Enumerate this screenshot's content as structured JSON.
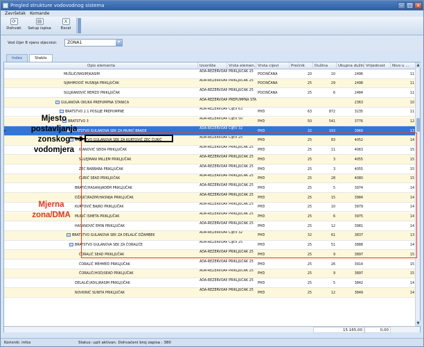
{
  "window": {
    "title": "Pregled strukture vodovodnog sistema"
  },
  "menu": [
    "Završetak",
    "Komande"
  ],
  "toolbar": {
    "refresh": "Dohvati",
    "print": "Setup ispisa",
    "excel": "Excel"
  },
  "filter": {
    "label": "Vod čijer 8 njens sljecnioi:",
    "value": "ZONA1"
  },
  "tabs": [
    "Index",
    "Stablo"
  ],
  "columns": [
    "Opis elementa",
    "Izvorište",
    "Vrsta elemen...",
    "Vrsta cijevi",
    "Prečnik",
    "Dužina",
    "Ukupna dužina",
    "Vrijednost",
    "Nivo u ..."
  ],
  "rows": [
    {
      "name": "MUŠLIĆ(RASIM)KASIM",
      "izv": "ADA-REZERVOAR HUM",
      "vrsta": "PRIKLJUČAK 25",
      "cijev": "POCINČANA",
      "p": "20",
      "d": "10",
      "ud": "2496",
      "v": "",
      "n": "11"
    },
    {
      "name": "SIJAHMOOIĆ HUSNIJA PRIKLJUČAK",
      "izv": "ADA-REZERVOAR HUM",
      "vrsta": "PRIKLJUČAK 25",
      "cijev": "POCINČANA",
      "p": "25",
      "d": "29",
      "ud": "2498",
      "v": "",
      "n": "11"
    },
    {
      "name": "SULJKANOVIĆ REMZO PRIKLJUČAK",
      "izv": "ADA-REZERVOAR HUM",
      "vrsta": "PRIKLJUČAK 25",
      "cijev": "POCINČANA",
      "p": "25",
      "d": "6",
      "ud": "2484",
      "v": "",
      "n": "11"
    },
    {
      "name": "GULANOVA OKUKA PREPUMPNA STANICA",
      "izv": "ADA-REZERVOAR HUM",
      "vrsta": "PREPUMPNA STANICA",
      "cijev": "",
      "p": "",
      "d": "",
      "ud": "2363",
      "v": "",
      "n": "10"
    },
    {
      "name": "BRATSTVO 2.1 POSLIJE PREPUMPNE",
      "izv": "ADA-REZERVOAR HUM",
      "vrsta": "CIJEV 63",
      "cijev": "PHD",
      "p": "63",
      "d": "872",
      "ud": "3235",
      "v": "",
      "n": "11"
    },
    {
      "name": "BRATSTVO 3",
      "izv": "ADA-REZERVOAR HUM",
      "vrsta": "CIJEV 50",
      "cijev": "PHD",
      "p": "50",
      "d": "541",
      "ud": "3776",
      "v": "",
      "n": "12"
    },
    {
      "name": "BRATSTVO GULANOVA SEK ZA MURIĆ BRADE",
      "izv": "ADA-REZERVOAR HUM",
      "vrsta": "CIJEV 32",
      "cijev": "PHD",
      "p": "32",
      "d": "193",
      "ud": "3969",
      "v": "",
      "n": "13"
    },
    {
      "name": "BRATSTVO GULANOVA SEK ZA KURTOVIĆ ZEC ĆURIĆ",
      "izv": "ADA-REZERVOAR HUM",
      "vrsta": "CIJEV 25",
      "cijev": "PHD",
      "p": "25",
      "d": "83",
      "ud": "4052",
      "v": "",
      "n": "14"
    },
    {
      "name": "IĆANOVIĆ SEIDA PRIKLJUČAK",
      "izv": "ADA-REZERVOAR HUM",
      "vrsta": "PRIKLJUČAK 25",
      "cijev": "PHD",
      "p": "25",
      "d": "11",
      "ud": "4063",
      "v": "",
      "n": "15"
    },
    {
      "name": "SULEJMANI MILLEM PRIKLJUČAK",
      "izv": "ADA-REZERVOAR HUM",
      "vrsta": "PRIKLJUČAK 25",
      "cijev": "PHD",
      "p": "25",
      "d": "3",
      "ud": "4055",
      "v": "",
      "n": "15"
    },
    {
      "name": "ZEC BARBARA PRIKLJUČAK",
      "izv": "ADA-REZERVOAR HUM",
      "vrsta": "PRIKLJUČAK 25",
      "cijev": "PHD",
      "p": "25",
      "d": "3",
      "ud": "4055",
      "v": "",
      "n": "15"
    },
    {
      "name": "ĆURIĆ SEAD PRIKLJUČAK",
      "izv": "ADA-REZERVOAR HUM",
      "vrsta": "PRIKLJUČAK 25",
      "cijev": "PHD",
      "p": "25",
      "d": "28",
      "ud": "4080",
      "v": "",
      "n": "15"
    },
    {
      "name": "BRATIĆ(HASAN)JADEM PRIKLJUČAK",
      "izv": "ADA-REZERVOAR HUM",
      "vrsta": "PRIKLJUČAK 25",
      "cijev": "PHD",
      "p": "25",
      "d": "5",
      "ud": "3974",
      "v": "",
      "n": "14"
    },
    {
      "name": "DŽAJIĆ(RAZIM)HASNIJA PRIKLJUČAK",
      "izv": "ADA-REZERVOAR HUM",
      "vrsta": "PRIKLJUČAK 25",
      "cijev": "PHD",
      "p": "25",
      "d": "15",
      "ud": "3984",
      "v": "",
      "n": "14"
    },
    {
      "name": "KURTOVIĆ BAJRO PRIKLJUČAK",
      "izv": "ADA-REZERVOAR HUM",
      "vrsta": "PRIKLJUČAK 25",
      "cijev": "PHD",
      "p": "25",
      "d": "10",
      "ud": "3979",
      "v": "",
      "n": "14"
    },
    {
      "name": "MURIĆ ISMETA PRIKLJUČAK",
      "izv": "ADA-REZERVOAR HUM",
      "vrsta": "PRIKLJUČAK 25",
      "cijev": "PHD",
      "p": "25",
      "d": "6",
      "ud": "3975",
      "v": "",
      "n": "14"
    },
    {
      "name": "HASANOVIĆ EMIN PRIKLJUČAK",
      "izv": "ADA-REZERVOAR HUM",
      "vrsta": "PRIKLJUČAK 25",
      "cijev": "PHD",
      "p": "25",
      "d": "12",
      "ud": "3981",
      "v": "",
      "n": "14"
    },
    {
      "name": "BRATSTVO GULANOVA SEK ZA DELALIĆ DŽAMBEK",
      "izv": "ADA-REZERVOAR HUM",
      "vrsta": "CIJEV 32",
      "cijev": "PHD",
      "p": "32",
      "d": "61",
      "ud": "3837",
      "v": "",
      "n": "13"
    },
    {
      "name": "BRATSTVO GULANOVA SEK ZA ĆORALIĆE",
      "izv": "ADA-REZERVOAR HUM",
      "vrsta": "CIJEV 25",
      "cijev": "PHD",
      "p": "25",
      "d": "51",
      "ud": "3888",
      "v": "",
      "n": "14"
    },
    {
      "name": "ĆORALIĆ SEAD PRIKLJUČAK",
      "izv": "ADA-REZERVOAR HUM",
      "vrsta": "PRIKLJUČAK 25",
      "cijev": "PHD",
      "p": "25",
      "d": "9",
      "ud": "3897",
      "v": "",
      "n": "15"
    },
    {
      "name": "ĆORALIĆ MEHMED PRIKLJUČAK",
      "izv": "ADA-REZERVOAR HUM",
      "vrsta": "PRIKLJUČAK 25",
      "cijev": "PHD",
      "p": "25",
      "d": "26",
      "ud": "3914",
      "v": "",
      "n": "15"
    },
    {
      "name": "ĆORALIĆ(HOD)SEAD PRIKLJUČAK",
      "izv": "ADA-REZERVOAR HUM",
      "vrsta": "PRIKLJUČAK 25",
      "cijev": "PHD",
      "p": "25",
      "d": "9",
      "ud": "3897",
      "v": "",
      "n": "15"
    },
    {
      "name": "DELALIĆ(ADIL)RASIM PRIKLJUČAK",
      "izv": "ADA-REZERVOAR HUM",
      "vrsta": "PRIKLJUČAK 25",
      "cijev": "PHD",
      "p": "25",
      "d": "5",
      "ud": "3842",
      "v": "",
      "n": "14"
    },
    {
      "name": "NOVKINIĆ SUNITA PRIKLJUČAK",
      "izv": "ADA-REZERVOAR HUM",
      "vrsta": "PRIKLJUČAK 25",
      "cijev": "PHD",
      "p": "25",
      "d": "12",
      "ud": "3849",
      "v": "",
      "n": "14"
    }
  ],
  "footer": {
    "total_len": "15.165,00",
    "total_value": "0,00"
  },
  "status": {
    "user": "Korisnik: infos",
    "state": "Status: upit aktivan. Dohvaćeni broj zapisa : 380"
  },
  "annotations": {
    "meter_placement": [
      "Mjesto",
      "postavljanja",
      "zonskog",
      "vodomjera"
    ],
    "zone": [
      "Mjerna",
      "zona/DMA"
    ]
  }
}
